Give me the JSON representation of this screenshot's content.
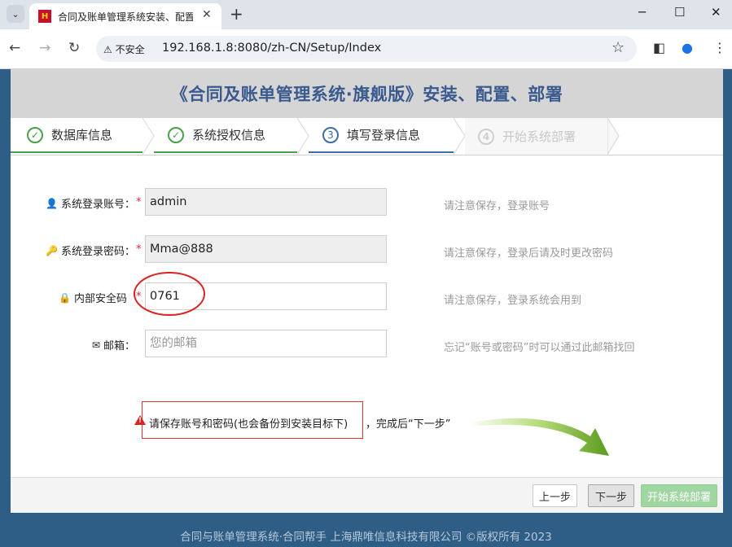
{
  "browser": {
    "tab_title": "合同及账单管理系统安装、配置",
    "favicon_text": "H",
    "security_label": "不安全",
    "url": "192.168.1.8:8080/zh-CN/Setup/Index",
    "icons": [
      "chevron-down-icon",
      "close-icon",
      "plus-icon",
      "minimize-icon",
      "maximize-icon",
      "window-close-icon",
      "back-icon",
      "forward-icon",
      "reload-icon",
      "warning-icon",
      "star-icon",
      "sidebar-icon",
      "profile-icon",
      "more-icon"
    ]
  },
  "header": {
    "title": "《合同及账单管理系统·旗舰版》安装、配置、部署"
  },
  "steps": [
    {
      "num": "✓",
      "label": "数据库信息",
      "state": "done"
    },
    {
      "num": "✓",
      "label": "系统授权信息",
      "state": "done"
    },
    {
      "num": "3",
      "label": "填写登录信息",
      "state": "current"
    },
    {
      "num": "4",
      "label": "开始系统部署",
      "state": "disabled"
    }
  ],
  "form": {
    "account": {
      "label": "系统登录账号：",
      "value": "admin",
      "hint": "请注意保存，登录账号",
      "icon": "user-icon"
    },
    "password": {
      "label": "系统登录密码：",
      "value": "Mma@888",
      "hint": "请注意保存，登录后请及时更改密码",
      "icon": "key-icon"
    },
    "security_code": {
      "label": "内部安全码",
      "value": "0761",
      "hint": "请注意保存，登录系统会用到",
      "icon": "lock-icon"
    },
    "email": {
      "label": "邮箱：",
      "placeholder": "您的邮箱",
      "hint": "忘记“账号或密码”时可以通过此邮箱找回",
      "icon": "envelope-icon"
    },
    "required_mark": "*"
  },
  "warning": {
    "text": "请保存账号和密码(也会备份到安装目标下)",
    "suffix": "，完成后“下一步”"
  },
  "buttons": {
    "prev": "上一步",
    "next": "下一步",
    "start": "开始系统部署"
  },
  "footer": {
    "copyright": "合同与账单管理系统·合同帮手 上海鼎唯信息科技有限公司 ©版权所有 2023"
  },
  "colors": {
    "accent_green": "#4aa04a",
    "accent_blue": "#3a6ea5",
    "page_bg": "#2e5d85",
    "annotation_red": "#e02020",
    "arrow_green": "#6aa52a"
  }
}
